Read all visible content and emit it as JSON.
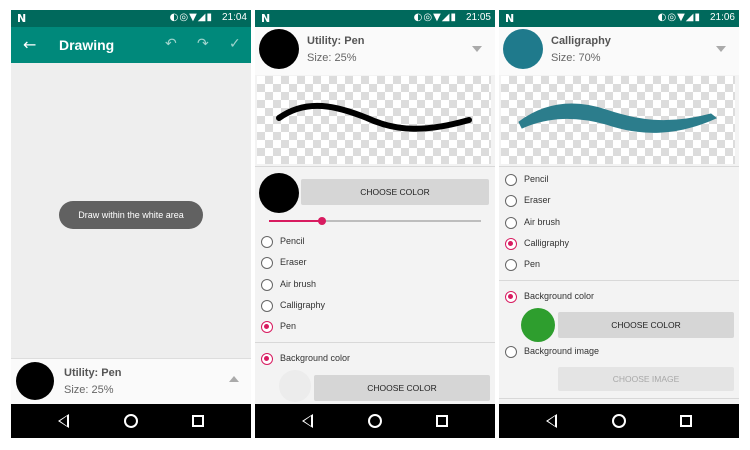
{
  "status": {
    "logo": "N",
    "icons": "◐◎▼◢▮",
    "times": [
      "21:04",
      "21:05",
      "21:06"
    ]
  },
  "screen1": {
    "toolbar": {
      "title": "Drawing",
      "back_glyph": "←",
      "undo_glyph": "↶",
      "redo_glyph": "↷",
      "check_glyph": "✓"
    },
    "toast": "Draw within the white area",
    "panel": {
      "utility": "Utility: Pen",
      "size": "Size: 25%",
      "color": "#000000"
    }
  },
  "screen2": {
    "header": {
      "utility": "Utility: Pen",
      "size": "Size: 25%",
      "color": "#000000"
    },
    "choose_color": "CHOOSE COLOR",
    "slider_fraction": 0.25,
    "tools": [
      "Pencil",
      "Eraser",
      "Air brush",
      "Calligraphy",
      "Pen"
    ],
    "selected_tool": "Pen",
    "background_color_label": "Background color",
    "background_choose_color": "CHOOSE COLOR"
  },
  "screen3": {
    "header": {
      "utility": "Calligraphy",
      "size": "Size: 70%",
      "color": "#1f7a8c"
    },
    "tools": [
      "Pencil",
      "Eraser",
      "Air brush",
      "Calligraphy",
      "Pen"
    ],
    "selected_tool": "Calligraphy",
    "background_color_label": "Background color",
    "background_color": "#2e9e2e",
    "choose_color": "CHOOSE COLOR",
    "background_image_label": "Background image",
    "choose_image": "CHOOSE IMAGE"
  },
  "colors": {
    "accent": "#d81b60",
    "toolbar": "#00897b",
    "statusbar": "#00695c"
  }
}
